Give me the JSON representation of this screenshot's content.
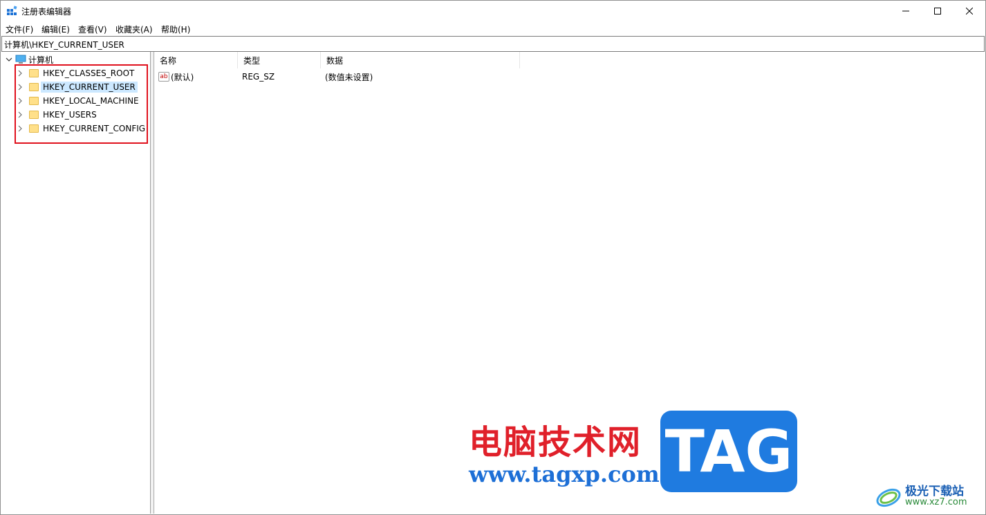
{
  "window": {
    "title": "注册表编辑器",
    "icon": "registry-editor-icon",
    "controls": {
      "minimize": "minimize-icon",
      "maximize": "maximize-icon",
      "close": "close-icon"
    }
  },
  "menu": {
    "items": [
      {
        "label": "文件(F)"
      },
      {
        "label": "编辑(E)"
      },
      {
        "label": "查看(V)"
      },
      {
        "label": "收藏夹(A)"
      },
      {
        "label": "帮助(H)"
      }
    ]
  },
  "address": {
    "path": "计算机\\HKEY_CURRENT_USER"
  },
  "tree": {
    "root": {
      "label": "计算机",
      "icon": "computer-icon"
    },
    "keys": [
      {
        "label": "HKEY_CLASSES_ROOT",
        "selected": false
      },
      {
        "label": "HKEY_CURRENT_USER",
        "selected": true
      },
      {
        "label": "HKEY_LOCAL_MACHINE",
        "selected": false
      },
      {
        "label": "HKEY_USERS",
        "selected": false
      },
      {
        "label": "HKEY_CURRENT_CONFIG",
        "selected": false
      }
    ]
  },
  "values": {
    "columns": [
      {
        "label": "名称"
      },
      {
        "label": "类型"
      },
      {
        "label": "数据"
      }
    ],
    "rows": [
      {
        "name": "(默认)",
        "type": "REG_SZ",
        "data": "(数值未设置)",
        "icon": "string-value-icon",
        "icon_text": "ab"
      }
    ]
  },
  "watermark": {
    "site_cn": "电脑技术网",
    "site_url": "www.tagxp.com",
    "badge": "TAG",
    "brand2_cn": "极光下载站",
    "brand2_url": "www.xz7.com"
  },
  "colors": {
    "selection": "#cce8ff",
    "highlight_box": "#e0101c",
    "folder": "#ffe08a"
  }
}
